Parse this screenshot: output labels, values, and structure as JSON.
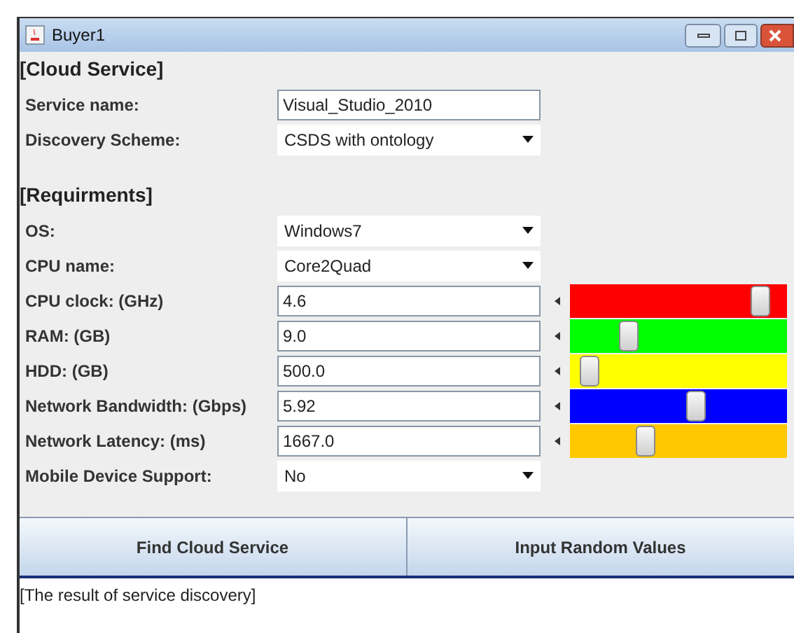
{
  "window": {
    "title": "Buyer1"
  },
  "sections": [
    {
      "heading": "[Cloud Service]",
      "rows": [
        {
          "kind": "text",
          "label": "Service name:",
          "value": "Visual_Studio_2010"
        },
        {
          "kind": "dropdown",
          "label": "Discovery Scheme:",
          "value": "CSDS with ontology"
        }
      ]
    },
    {
      "heading": "[Requirments]",
      "rows": [
        {
          "kind": "dropdown",
          "label": "OS:",
          "value": "Windows7"
        },
        {
          "kind": "dropdown",
          "label": "CPU name:",
          "value": "Core2Quad"
        },
        {
          "kind": "slider",
          "label": "CPU clock: (GHz)",
          "value": "4.6",
          "level": 0.88,
          "color": "#ff0000"
        },
        {
          "kind": "slider",
          "label": "RAM: (GB)",
          "value": "9.0",
          "level": 0.27,
          "color": "#00ff00"
        },
        {
          "kind": "slider",
          "label": "HDD: (GB)",
          "value": "500.0",
          "level": 0.09,
          "color": "#ffff00"
        },
        {
          "kind": "slider",
          "label": "Network Bandwidth: (Gbps)",
          "value": "5.92",
          "level": 0.58,
          "color": "#0000ff"
        },
        {
          "kind": "slider",
          "label": "Network Latency: (ms)",
          "value": "1667.0",
          "level": 0.35,
          "color": "#ffc800"
        },
        {
          "kind": "dropdown",
          "label": "Mobile Device Support:",
          "value": "No"
        }
      ]
    }
  ],
  "buttons": [
    "Find Cloud Service",
    "Input Random Values"
  ],
  "result": "[The result of service discovery]"
}
